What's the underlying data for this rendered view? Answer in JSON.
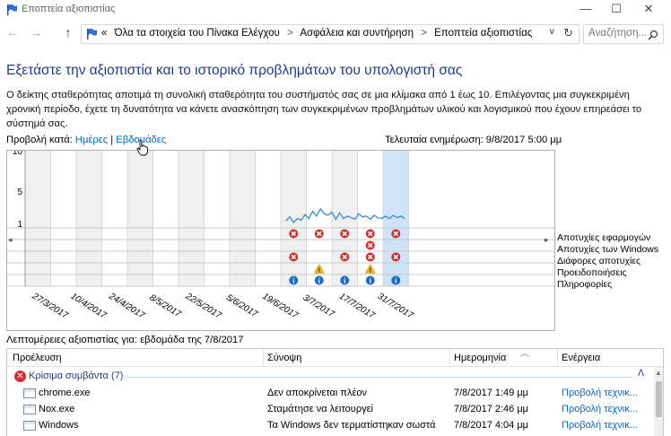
{
  "window": {
    "title": "Εποπτεία αξιοπιστίας",
    "minimize": "—",
    "maximize": "☐",
    "close": "✕"
  },
  "nav": {
    "back": "←",
    "forward": "→",
    "up": "↑",
    "chevrons": "«",
    "breadcrumbs": [
      "Όλα τα στοιχεία του Πίνακα Ελέγχου",
      "Ασφάλεια και συντήρηση",
      "Εποπτεία αξιοπιστίας"
    ],
    "dropdown": "∨",
    "refresh": "↻",
    "search_placeholder": "Αναζήτηση..."
  },
  "heading": "Εξετάστε την αξιοπιστία και το ιστορικό προβλημάτων του υπολογιστή σας",
  "description": "Ο δείκτης σταθερότητας αποτιμά τη συνολική σταθερότητα του συστήματός σας σε μια κλίμακα από 1 έως 10. Επιλέγοντας μια συγκεκριμένη χρονική περίοδο, έχετε τη δυνατότητα να κάνετε ανασκόπηση των συγκεκριμένων προβλημάτων υλικού και λογισμικού που έχουν επηρεάσει το σύστημά σας.",
  "view_by": {
    "label": "Προβολή κατά:",
    "days": "Ημέρες",
    "sep": "|",
    "weeks": "Εβδομάδες"
  },
  "last_updated": "Τελευταία ενημέρωση: 9/8/2017 5:00 μμ",
  "colors": {
    "heading": "#1e3b87",
    "link": "#0066cc",
    "error": "#d32f2f",
    "warning": "#f2b705",
    "info": "#1a6fc4",
    "line": "#3a8ad6",
    "selected": "#cfe3f7"
  },
  "chart_data": {
    "type": "line",
    "title": "",
    "ylabel": "",
    "ylim": [
      1,
      10
    ],
    "y_ticks": [
      "10",
      "5",
      "1"
    ],
    "x_tick_labels": [
      "27/3/2017",
      "10/4/2017",
      "24/4/2017",
      "8/5/2017",
      "22/5/2017",
      "5/6/2017",
      "19/6/2017",
      "3/7/2017",
      "17/7/2017",
      "31/7/2017"
    ],
    "weeks": 15,
    "selected_week": 14,
    "stability_series": {
      "name": "",
      "x": [
        10.2,
        10.35,
        10.5,
        10.65,
        10.8,
        10.95,
        11.1,
        11.25,
        11.4,
        11.55,
        11.7,
        11.85,
        12.0,
        12.15,
        12.3,
        12.45,
        12.6,
        12.75,
        12.9,
        13.05,
        13.2,
        13.35,
        13.5,
        13.65,
        13.8,
        13.95,
        14.1,
        14.25,
        14.4,
        14.55,
        14.7,
        14.85
      ],
      "values": [
        1.3,
        1.8,
        1.1,
        1.6,
        1.4,
        2.1,
        1.6,
        2.5,
        1.9,
        2.8,
        2.2,
        2.0,
        2.4,
        1.5,
        2.3,
        1.6,
        1.9,
        1.7,
        1.5,
        2.2,
        1.8,
        1.9,
        1.5,
        2.0,
        1.7,
        1.6,
        1.9,
        1.6,
        2.0,
        1.7,
        1.9,
        1.6
      ]
    },
    "rows": [
      {
        "label": "Αποτυχίες εφαρμογών",
        "icon": "error",
        "weeks": [
          10,
          11,
          12,
          13,
          14
        ]
      },
      {
        "label": "Αποτυχίες των Windows",
        "icon": "error",
        "weeks": [
          13
        ]
      },
      {
        "label": "Διάφορες αποτυχίες",
        "icon": "error",
        "weeks": [
          10,
          12,
          13,
          14
        ]
      },
      {
        "label": "Προειδοποιήσεις",
        "icon": "warning",
        "weeks": [
          11,
          13
        ]
      },
      {
        "label": "Πληροφορίες",
        "icon": "info",
        "weeks": [
          10,
          11,
          12,
          13,
          14
        ]
      }
    ]
  },
  "details": {
    "title": "Λεπτομέρειες αξιοπιστίας για: εβδομάδα της 7/8/2017",
    "columns": [
      "Προέλευση",
      "Σύνοψη",
      "Ημερομηνία",
      "Ενέργεια"
    ],
    "group": {
      "icon": "✕",
      "label": "Κρίσιμα συμβάντα (7)",
      "chevron": "ᐱ"
    },
    "rows": [
      {
        "source": "chrome.exe",
        "summary": "Δεν αποκρίνεται πλέον",
        "date": "7/8/2017 1:49 μμ",
        "action": "Προβολή τεχνικ..."
      },
      {
        "source": "Nox.exe",
        "summary": "Σταμάτησε να λειτουργεί",
        "date": "7/8/2017 2:46 μμ",
        "action": "Προβολή τεχνικ..."
      },
      {
        "source": "Windows",
        "summary": "Τα Windows δεν τερματίστηκαν σωστά",
        "date": "7/8/2017 4:04 μμ",
        "action": "Προβολή τεχνικ..."
      },
      {
        "source": "",
        "summary": "",
        "date": "",
        "action": ""
      }
    ]
  }
}
